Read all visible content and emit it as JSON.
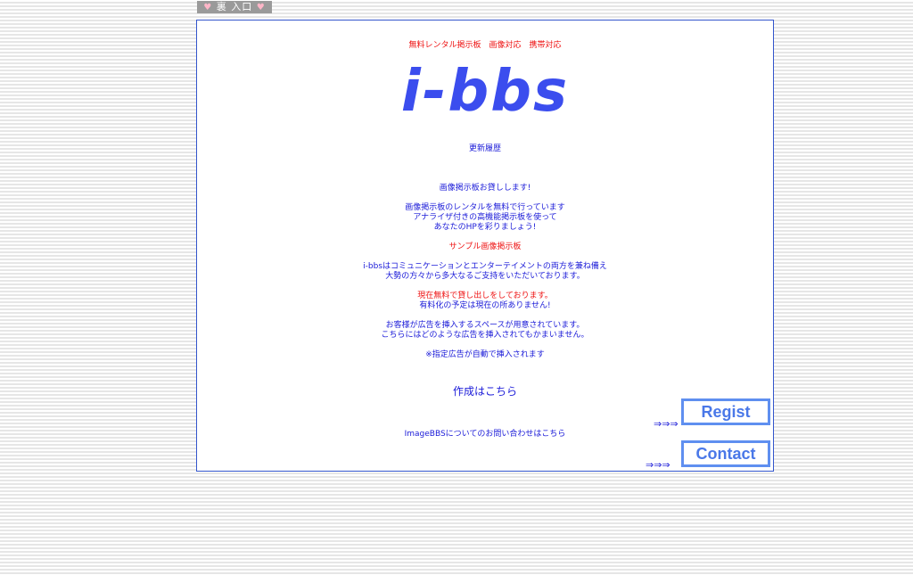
{
  "top_link": {
    "label": "裏 入口"
  },
  "tagline": "無料レンタル掲示板　画像対応　携帯対応",
  "logo": "i-bbs",
  "update_history": "更新履歴",
  "intro": {
    "headline": "画像掲示板お貸しします!",
    "lines": [
      "画像掲示板のレンタルを無料で行っています",
      "アナライザ付きの高機能掲示板を使って",
      "あなたのHPを彩りましょう!"
    ]
  },
  "sample_link": "サンプル画像掲示板",
  "description": [
    "i-bbsはコミュニケーションとエンターテイメントの両方を兼ね備え",
    "大勢の方々から多大なるご支持をいただいております。"
  ],
  "free_notice": {
    "red_line": "現在無料で貸し出しをしております。",
    "line": "有料化の予定は現在の所ありません!"
  },
  "ads": [
    "お客様が広告を挿入するスペースが用意されています。",
    "こちらにはどのような広告を挿入されてもかまいません。"
  ],
  "ads_note": "※指定広告が自動で挿入されます",
  "create_link": "作成はこちら",
  "contact_text": "ImageBBSについてのお問い合わせはこちら",
  "arrows": "⇒⇒⇒",
  "buttons": {
    "regist": "Regist",
    "contact": "Contact"
  },
  "colors": {
    "text_blue": "#1a1ad8",
    "red": "#ee1111",
    "logo": "#3b4dee",
    "button": "#5f8ff0"
  }
}
